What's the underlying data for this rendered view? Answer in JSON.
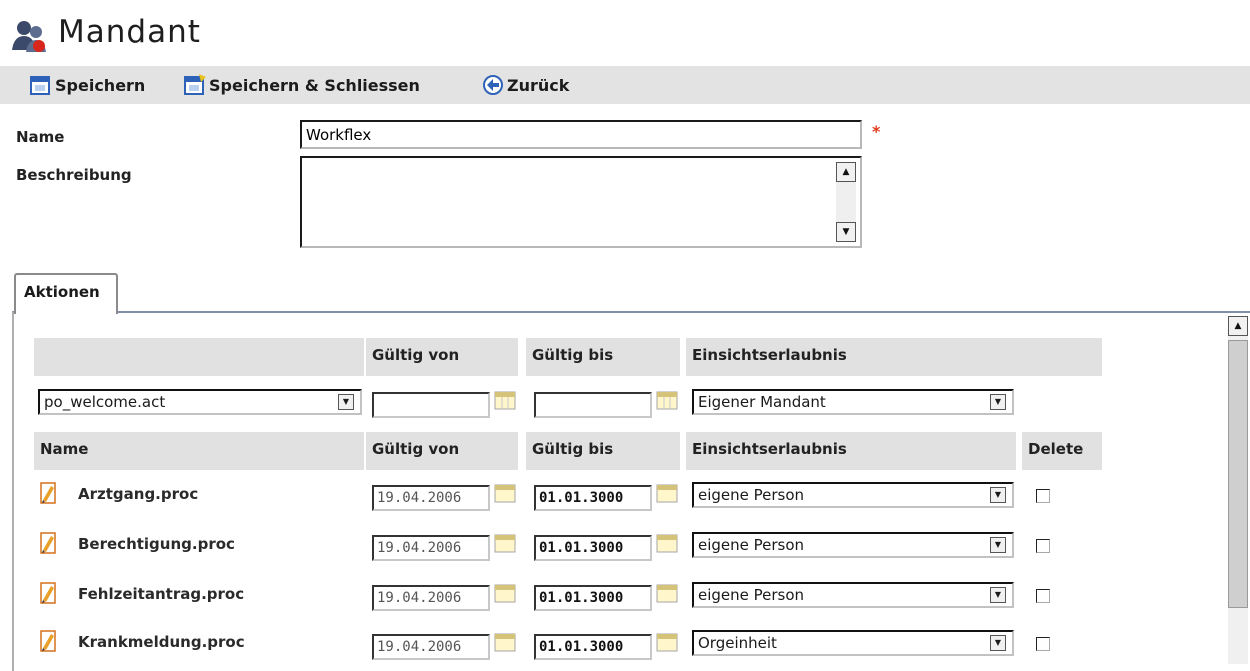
{
  "title": "Mandant",
  "toolbar": {
    "save": "Speichern",
    "save_close": "Speichern & Schliessen",
    "back": "Zurück"
  },
  "form": {
    "name_label": "Beschreibung",
    "name_label_top": "Name",
    "name_value": "Workflex",
    "required_mark": "*"
  },
  "tabs": [
    {
      "label": "Aktionen"
    }
  ],
  "filter_header": {
    "valid_from": "Gültig von",
    "valid_to": "Gültig bis",
    "permission": "Einsichtserlaubnis"
  },
  "filter_row": {
    "action_select": "po_welcome.act",
    "valid_from": "",
    "valid_to": "",
    "permission_select": "Eigener Mandant"
  },
  "table": {
    "columns": [
      "Name",
      "Gültig von",
      "Gültig bis",
      "Einsichtserlaubnis",
      "Delete"
    ],
    "rows": [
      {
        "name": "Arztgang.proc",
        "from": "19.04.2006",
        "to": "01.01.3000",
        "permission": "eigene Person"
      },
      {
        "name": "Berechtigung.proc",
        "from": "19.04.2006",
        "to": "01.01.3000",
        "permission": "eigene Person"
      },
      {
        "name": "Fehlzeitantrag.proc",
        "from": "19.04.2006",
        "to": "01.01.3000",
        "permission": "eigene Person"
      },
      {
        "name": "Krankmeldung.proc",
        "from": "19.04.2006",
        "to": "01.01.3000",
        "permission": "Orgeinheit"
      }
    ]
  },
  "colors": {
    "toolbar_bg": "#e3e3e3",
    "header_bg": "#e1e1e1",
    "required": "#e23a1d"
  }
}
